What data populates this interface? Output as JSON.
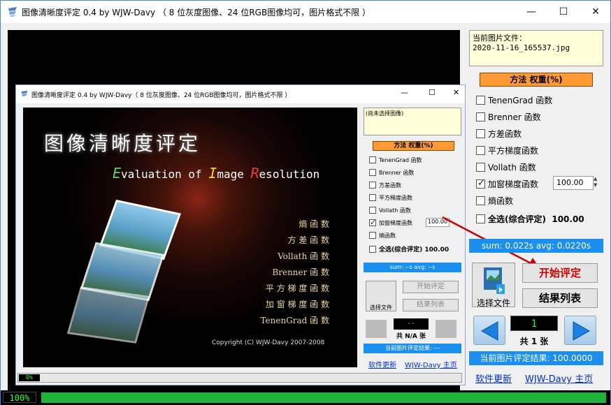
{
  "window": {
    "title": "图像清晰度评定 0.4 by WJW-Davy （ 8 位灰度图像、24 位RGB图像均可，图片格式不限 ）",
    "minimize": "—",
    "maximize": "☐",
    "close": "✕"
  },
  "inner": {
    "title": "图像清晰度评定 0.4 by WJW-Davy（ 8 位灰度图像、24 位RGB图像均可，图片格式不限 ）",
    "splash": {
      "title_cn": "图像清晰度评定",
      "title_en_parts": [
        "E",
        "valuation of ",
        "I",
        "mage ",
        "R",
        "esolution"
      ],
      "items": [
        "熵 函 数",
        "方 差 函 数",
        "Vollath 函 数",
        "Brenner 函 数",
        "平 方 梯 度 函 数",
        "加 窗 梯 度 函 数",
        "TenenGrad 函 数"
      ],
      "copyright": "Copyright (C) WJW-Davy 2007-2008"
    },
    "file_box": "(尚未选择图像)",
    "method_header": "方法  权重(%)",
    "methods": [
      "TenenGrad 函数",
      "Brenner 函数",
      "方差函数",
      "平方梯度函数",
      "Vollath 函数",
      "加窗梯度函数",
      "熵函数"
    ],
    "window_weight": "100.00",
    "select_all": "全选(综合评定)",
    "select_all_weight": "100.00",
    "sum_text": "sum: --s  avg: --s",
    "select_file": "选择文件",
    "start_eval": "开始评定",
    "result_list": "结果列表",
    "lcd": "--",
    "total": "共 N/A 张",
    "current_result": "当前图片评定结果: ---",
    "link_update": "软件更新",
    "link_home": "WJW-Davy 主页",
    "progress": "0%"
  },
  "right": {
    "file_label": "当前图片文件：",
    "file_name": "2020-11-16_165537.jpg",
    "method_header": "方法  权重(%)",
    "methods": [
      {
        "label": "TenenGrad 函数",
        "checked": false
      },
      {
        "label": "Brenner 函数",
        "checked": false
      },
      {
        "label": "方差函数",
        "checked": false
      },
      {
        "label": "平方梯度函数",
        "checked": false
      },
      {
        "label": "Vollath 函数",
        "checked": false
      },
      {
        "label": "加窗梯度函数",
        "checked": true
      },
      {
        "label": "熵函数",
        "checked": false
      }
    ],
    "window_weight": "100.00",
    "select_all": "全选(综合评定)",
    "select_all_weight": "100.00",
    "sum_text": "sum: 0.022s  avg: 0.0220s",
    "select_file": "选择文件",
    "start_eval": "开始评定",
    "result_list": "结果列表",
    "lcd": "1",
    "total": "共 1 张",
    "current_result": "当前图片评定结果: 100.0000",
    "link_update": "软件更新",
    "link_home": "WJW-Davy 主页"
  },
  "status": {
    "progress": "100%",
    "progress_fraction": 1.0
  },
  "colors": {
    "orange": "#ff9933",
    "blue": "#1a8ff0",
    "green": "#1db33a",
    "red_text": "#cc0000"
  }
}
